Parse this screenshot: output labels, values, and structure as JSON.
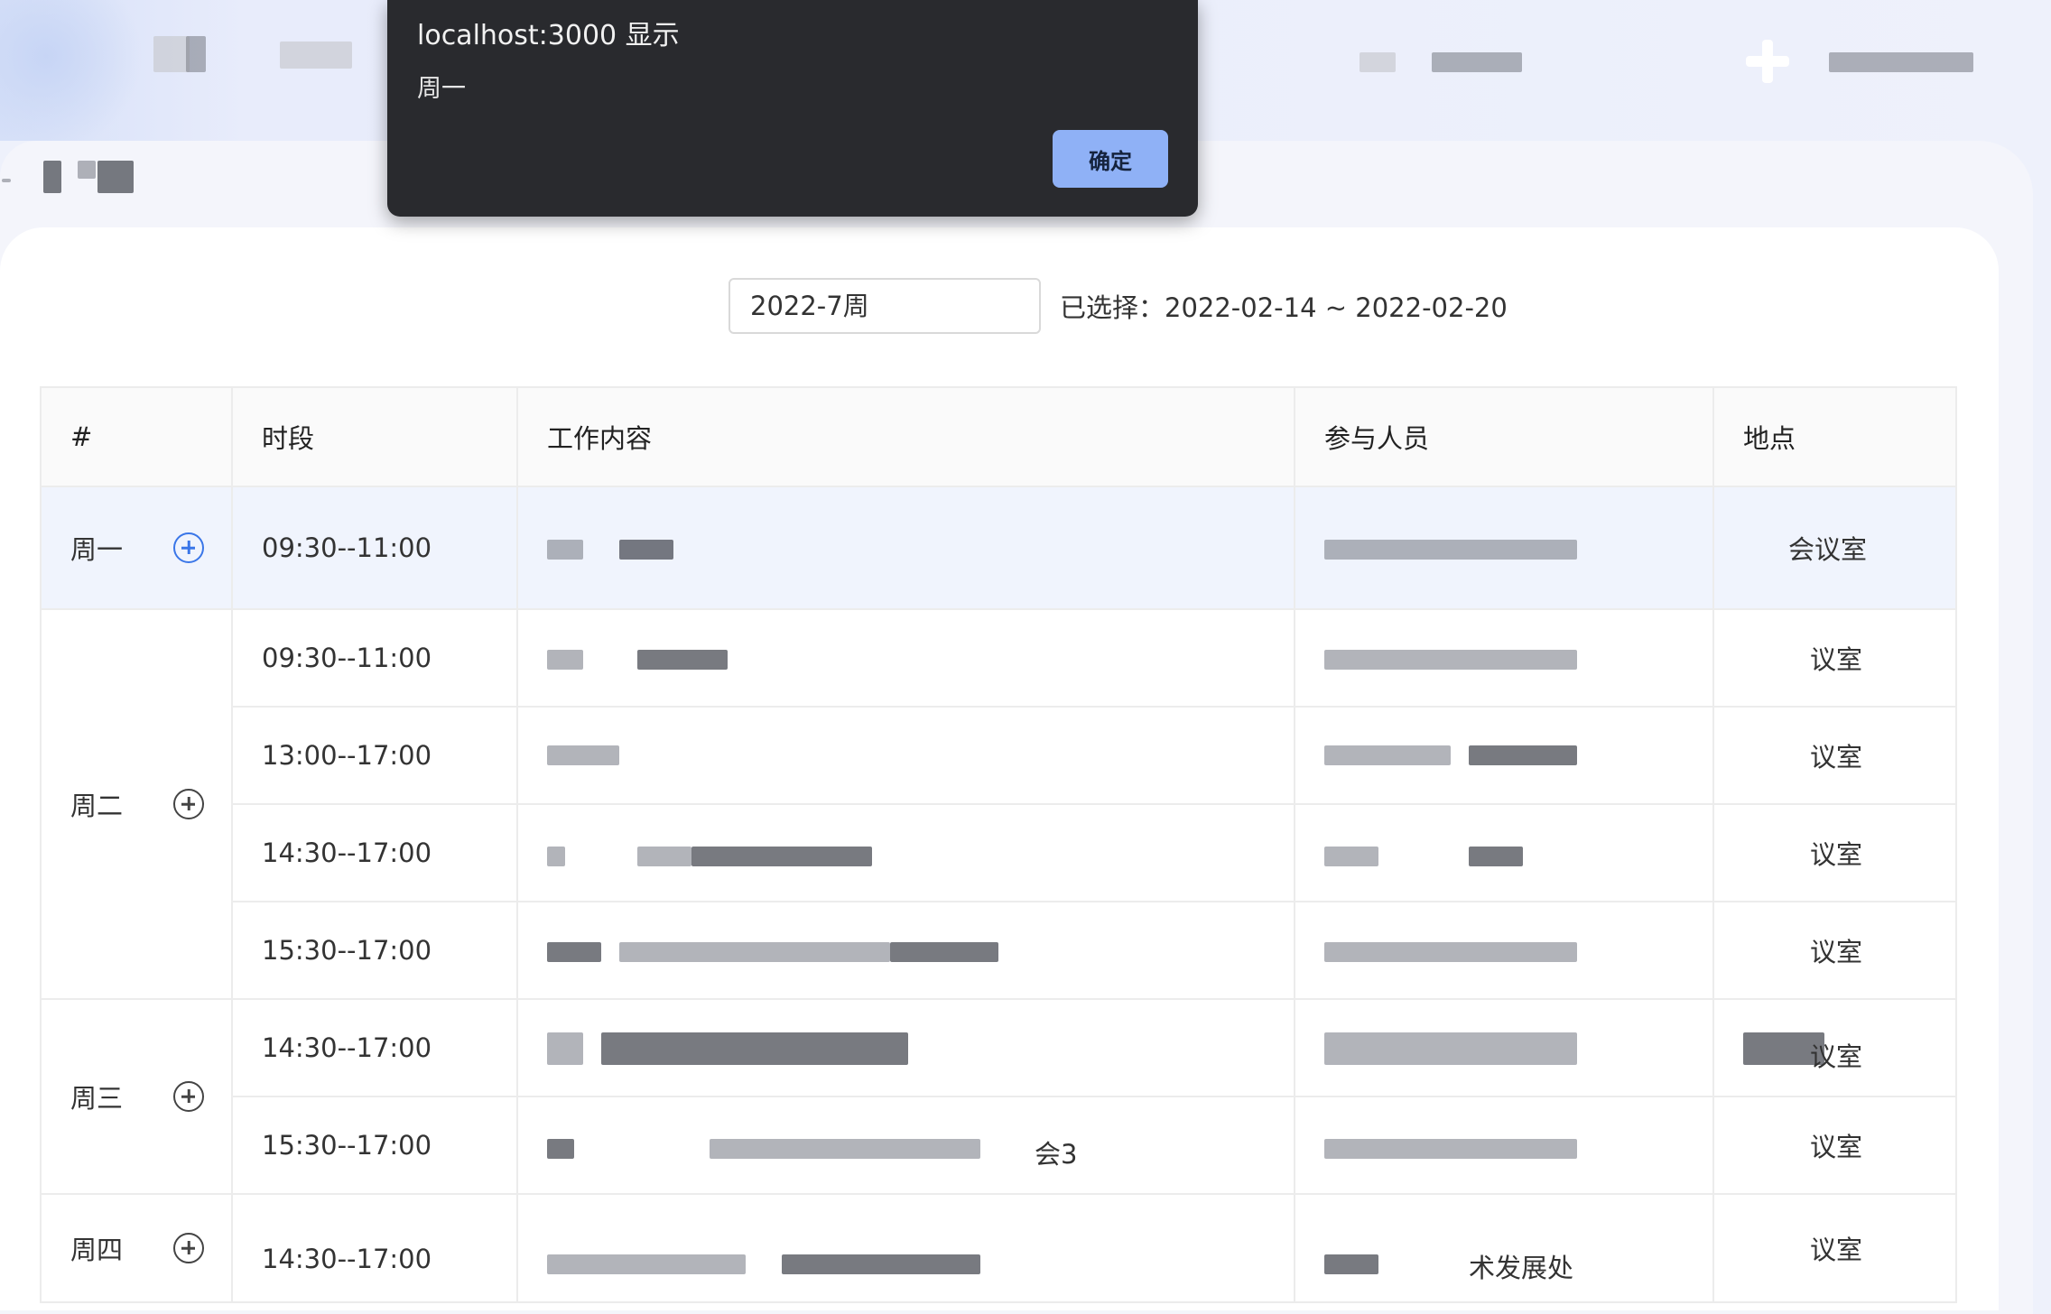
{
  "dialog": {
    "title": "localhost:3000 显示",
    "message": "周一",
    "ok_label": "确定"
  },
  "topbar": {
    "trail_text": "..."
  },
  "filter": {
    "week_value": "2022-7周",
    "range_text": "已选择：2022-02-14 ~ 2022-02-20"
  },
  "table": {
    "headers": [
      "#",
      "时段",
      "工作内容",
      "参与人员",
      "地点"
    ],
    "days": [
      "周一",
      "周二",
      "周三",
      "周四"
    ],
    "times": [
      "09:30--11:00",
      "09:30--11:00",
      "13:00--17:00",
      "14:30--17:00",
      "15:30--17:00",
      "14:30--17:00",
      "15:30--17:00",
      "14:30--17:00"
    ],
    "locations": [
      "会议室",
      "议室",
      "议室",
      "议室",
      "议室",
      "议室",
      "议室",
      "议室"
    ],
    "participant_tail": "术发展处",
    "content_tail": "会3"
  },
  "colors": {
    "accent_blue": "#3a76e8",
    "dialog_bg": "#292a2e",
    "ok_button": "#8fb1f6",
    "selected_row": "#f0f4fd"
  }
}
